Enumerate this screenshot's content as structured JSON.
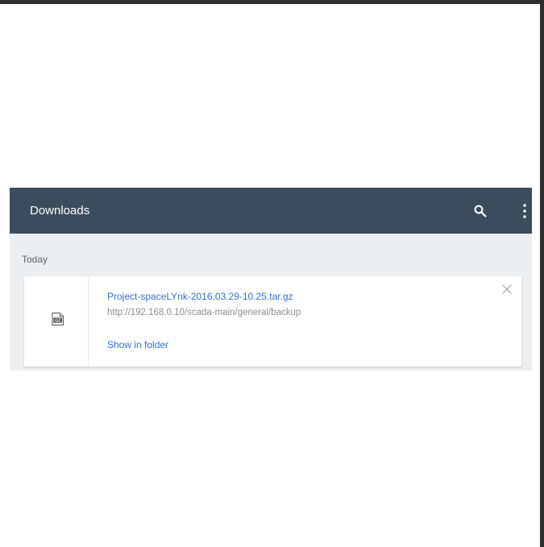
{
  "header": {
    "title": "Downloads",
    "search_icon": "search-icon",
    "menu_icon": "more-vert-icon",
    "background_color": "#3c4c5f"
  },
  "downloads": {
    "section_title": "Today",
    "items": [
      {
        "file_name": "Project-spaceLYnk-2016.03.29-10.25.tar.gz",
        "source_url": "http://192.168.0.10/scada-main/general/backup",
        "action_label": "Show in folder",
        "file_icon": "gz-file-icon",
        "file_icon_text": "GZ",
        "close_icon": "close-icon"
      }
    ]
  },
  "colors": {
    "panel_background": "#eceff1",
    "link": "#2f6fd0",
    "secondary_text": "#8a8d90",
    "frame_border": "#2f2f2f"
  }
}
